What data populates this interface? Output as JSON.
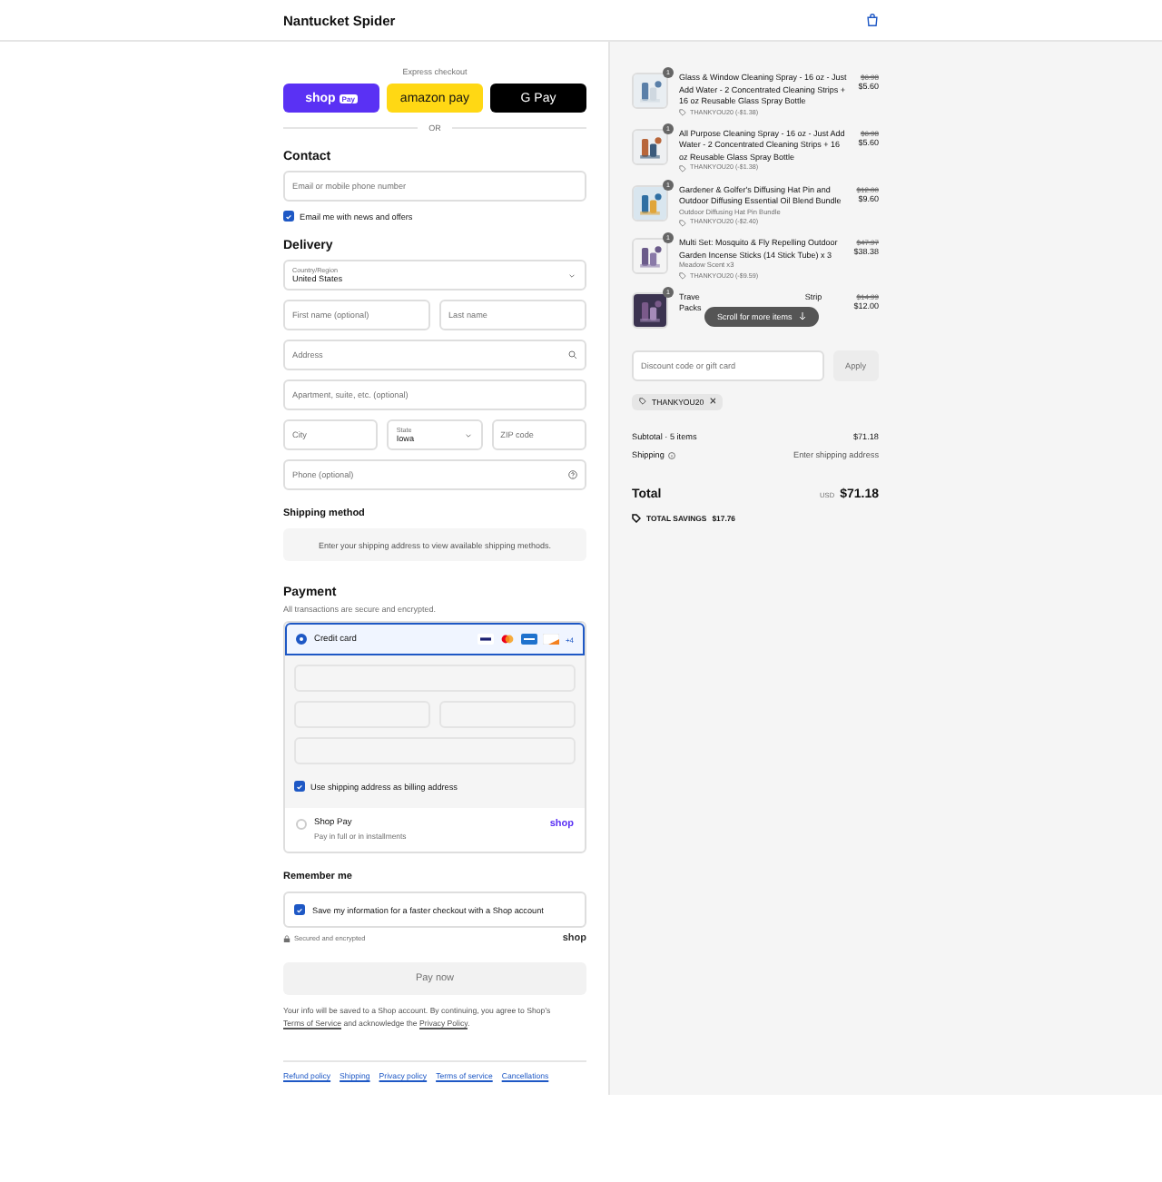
{
  "header": {
    "store_name": "Nantucket Spider"
  },
  "express": {
    "label": "Express checkout",
    "buttons": [
      {
        "kind": "shop",
        "label": "shop",
        "badge": "Pay"
      },
      {
        "kind": "amazon",
        "label": "amazon pay"
      },
      {
        "kind": "google",
        "label": "G Pay"
      }
    ],
    "divider": "OR"
  },
  "contact": {
    "title": "Contact",
    "email": {
      "placeholder": "Email or mobile phone number"
    },
    "newsletter": {
      "label": "Email me with news and offers",
      "checked": true
    }
  },
  "delivery": {
    "title": "Delivery",
    "rows": [
      [
        {
          "kind": "select",
          "label": "Country/Region",
          "value": "United States"
        }
      ],
      [
        {
          "kind": "text",
          "placeholder": "First name (optional)"
        },
        {
          "kind": "text",
          "placeholder": "Last name"
        }
      ],
      [
        {
          "kind": "address",
          "placeholder": "Address"
        }
      ],
      [
        {
          "kind": "text",
          "placeholder": "Apartment, suite, etc. (optional)"
        }
      ],
      [
        {
          "kind": "text",
          "placeholder": "City"
        },
        {
          "kind": "select",
          "label": "State",
          "value": "Iowa"
        },
        {
          "kind": "text",
          "placeholder": "ZIP code"
        }
      ],
      [
        {
          "kind": "phone",
          "placeholder": "Phone (optional)"
        }
      ]
    ]
  },
  "shipping_method": {
    "title": "Shipping method",
    "message": "Enter your shipping address to view available shipping methods."
  },
  "payment": {
    "title": "Payment",
    "subtitle": "All transactions are secure and encrypted.",
    "more_brands": "+4",
    "methods": [
      {
        "kind": "card",
        "label": "Credit card",
        "selected": true
      },
      {
        "kind": "shop_pay",
        "label": "Shop Pay",
        "sublabel": "Pay in full or in installments",
        "brand": "shop",
        "selected": false
      }
    ],
    "billing": {
      "label": "Use shipping address as billing address",
      "checked": true
    }
  },
  "remember": {
    "title": "Remember me",
    "option": {
      "label": "Save my information for a faster checkout with a Shop account",
      "checked": true
    },
    "secure": "Secured and encrypted",
    "brand": "shop"
  },
  "pay_button": "Pay now",
  "legal": [
    {
      "text": "Your info will be saved to a Shop account. By continuing, you agree to Shop’s "
    },
    {
      "text": "Terms of Service",
      "link": true
    },
    {
      "text": " and acknowledge the "
    },
    {
      "text": "Privacy Policy",
      "link": true
    },
    {
      "text": "."
    }
  ],
  "footer_links": [
    "Refund policy",
    "Shipping",
    "Privacy policy",
    "Terms of service",
    "Cancellations"
  ],
  "cart": {
    "items": [
      {
        "quantity": "1",
        "name": "Glass & Window Cleaning Spray - 16 oz - Just Add Water - 2 Concentrated Cleaning Strips + 16 oz Reusable Glass Spray Bottle",
        "discount": "THANKYOU20 (-$1.38)",
        "original_price": "$6.98",
        "price": "$5.60"
      },
      {
        "quantity": "1",
        "name": "All Purpose Cleaning Spray - 16 oz - Just Add Water - 2 Concentrated Cleaning Strips + 16 oz Reusable Glass Spray Bottle",
        "discount": "THANKYOU20 (-$1.38)",
        "original_price": "$6.98",
        "price": "$5.60"
      },
      {
        "quantity": "1",
        "name": "Gardener & Golfer's Diffusing Hat Pin and Outdoor Diffusing Essential Oil Blend Bundle",
        "variant": "Outdoor Diffusing Hat Pin Bundle",
        "discount": "THANKYOU20 (-$2.40)",
        "original_price": "$12.00",
        "price": "$9.60"
      },
      {
        "quantity": "1",
        "name": "Multi Set: Mosquito & Fly Repelling Outdoor Garden Incense Sticks (14 Stick Tube) x 3",
        "variant": "Meadow Scent x3",
        "discount": "THANKYOU20 (-$9.59)",
        "original_price": "$47.97",
        "price": "$38.38"
      },
      {
        "quantity": "1",
        "name_start": "Trave",
        "name_end": "Strip",
        "name_line2": "Packs",
        "original_price": "$14.99",
        "price": "$12.00"
      }
    ],
    "scroll_hint": "Scroll for more items",
    "discount": {
      "placeholder": "Discount code or gift card",
      "button": "Apply"
    },
    "applied_codes": [
      "THANKYOU20"
    ],
    "summary": {
      "subtotal_label": "Subtotal · 5 items",
      "subtotal": "$71.18",
      "shipping_label": "Shipping",
      "shipping_value": "Enter shipping address",
      "total_label": "Total",
      "currency": "USD",
      "total": "$71.18",
      "savings_label": "TOTAL SAVINGS",
      "savings": "$17.76"
    }
  }
}
